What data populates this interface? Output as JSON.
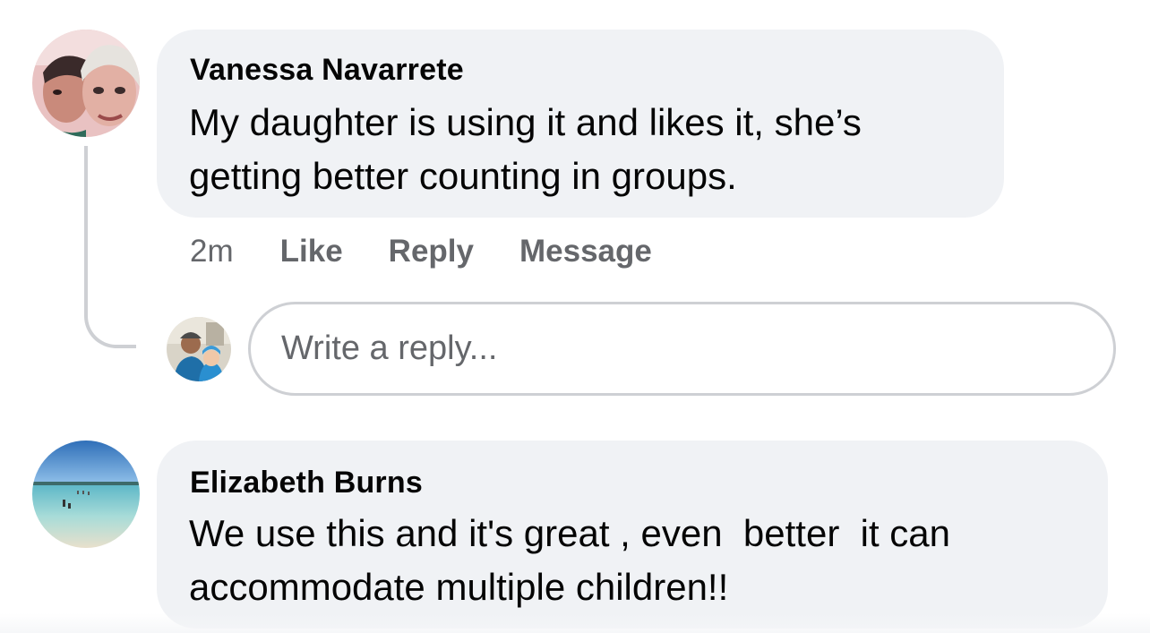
{
  "comments": [
    {
      "author": "Vanessa Navarrete",
      "text_lines": [
        "My daughter is using it and likes it, she’s",
        "getting better counting in groups."
      ],
      "time": "2m",
      "actions": {
        "like": "Like",
        "reply": "Reply",
        "message": "Message"
      },
      "avatar_icon": "selfie-avatar"
    },
    {
      "author": "Elizabeth Burns",
      "text_lines": [
        "We use this and it's great , even  better  it can",
        "accommodate multiple children!!"
      ],
      "avatar_icon": "beach-avatar"
    }
  ],
  "reply_composer": {
    "placeholder": "Write a reply...",
    "avatar_icon": "user-avatar"
  },
  "colors": {
    "bubble": "#f0f2f5",
    "secondary_text": "#65676b",
    "border": "#ced0d4"
  }
}
